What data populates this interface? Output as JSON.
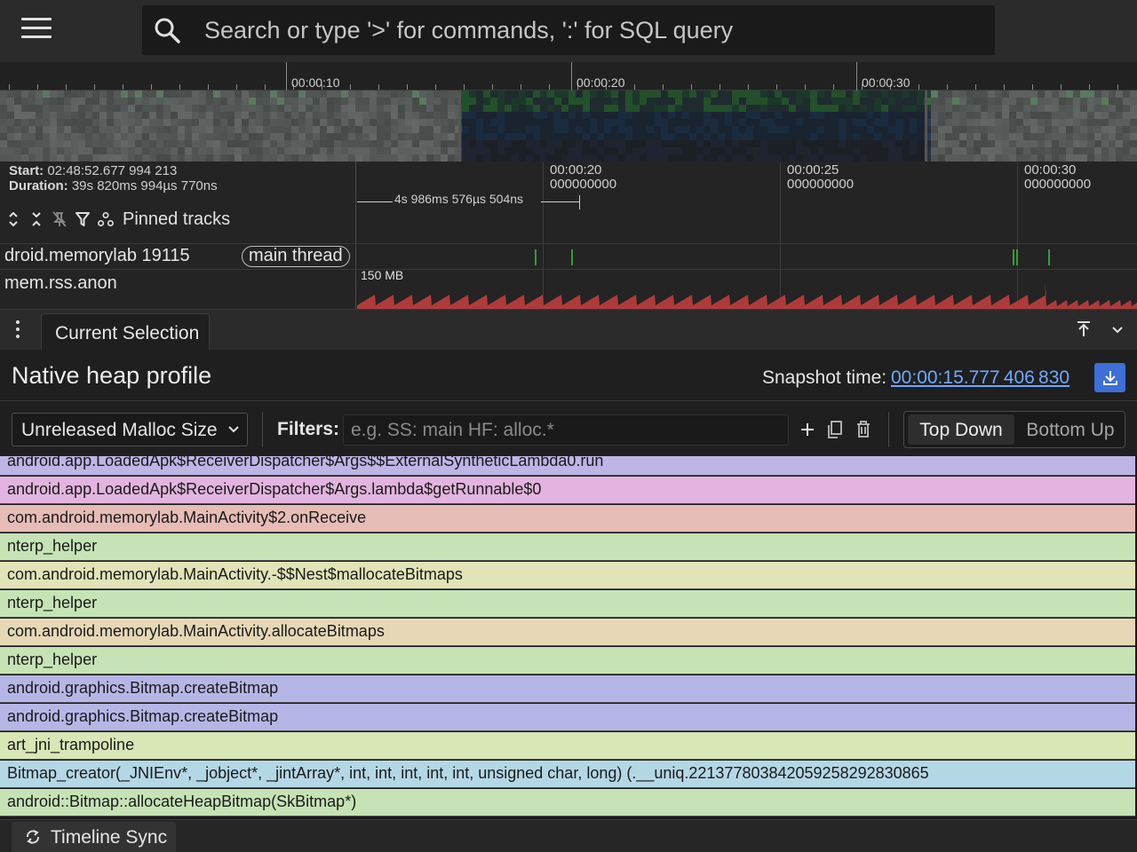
{
  "topbar": {
    "menu_icon": "hamburger-menu-icon",
    "search_icon": "search-icon",
    "search_placeholder": "Search or type '>' for commands, ':' for SQL query"
  },
  "overview": {
    "time_labels": [
      "00:00:10",
      "00:00:20",
      "00:00:30"
    ]
  },
  "tracks": {
    "start_label": "Start:",
    "start_value": "02:48:52.677 994 213",
    "duration_label": "Duration:",
    "duration_value": "39s 820ms 994µs 770ns",
    "pinned_label": "Pinned tracks",
    "span_label": "4s 986ms 576µs 504ns",
    "time_labels": [
      {
        "time": "00:00:20",
        "sub": "000000000"
      },
      {
        "time": "00:00:25",
        "sub": "000000000"
      },
      {
        "time": "00:00:30",
        "sub": "000000000"
      }
    ],
    "process_track": "droid.memorylab 19115",
    "thread_chip": "main thread",
    "counter_track": "mem.rss.anon",
    "counter_value": "150 MB",
    "counter_color": "#b03a3a"
  },
  "panel": {
    "tab_current": "Current Selection",
    "title": "Native heap profile",
    "snapshot_label": "Snapshot time:",
    "snapshot_value": "00:00:15.777 406 830",
    "metric_value": "Unreleased Malloc Size",
    "filters_label": "Filters:",
    "filters_placeholder": "e.g. SS: main HF: alloc.*",
    "view_top_down": "Top Down",
    "view_bottom_up": "Bottom Up",
    "accent": "#3d6fd6"
  },
  "flamegraph": {
    "frames": [
      {
        "label": "android.app.LoadedApk$ReceiverDispatcher$Args$$ExternalSyntheticLambda0.run",
        "color": "#bfb4e6"
      },
      {
        "label": "android.app.LoadedApk$ReceiverDispatcher$Args.lambda$getRunnable$0",
        "color": "#e3b4df"
      },
      {
        "label": "com.android.memorylab.MainActivity$2.onReceive",
        "color": "#e6bcb6"
      },
      {
        "label": "nterp_helper",
        "color": "#c6e3b5"
      },
      {
        "label": "com.android.memorylab.MainActivity.-$$Nest$mallocateBitmaps",
        "color": "#e2e3b7"
      },
      {
        "label": "nterp_helper",
        "color": "#c6e3b5"
      },
      {
        "label": "com.android.memorylab.MainActivity.allocateBitmaps",
        "color": "#e6d8b6"
      },
      {
        "label": "nterp_helper",
        "color": "#c6e3b5"
      },
      {
        "label": "android.graphics.Bitmap.createBitmap",
        "color": "#b6b6e6"
      },
      {
        "label": "android.graphics.Bitmap.createBitmap",
        "color": "#b6b6e6"
      },
      {
        "label": "art_jni_trampoline",
        "color": "#d9e6b6"
      },
      {
        "label": "Bitmap_creator(_JNIEnv*, _jobject*, _jintArray*, int, int, int, int, int, unsigned char, long) (.__uniq.221377803842059258292830865",
        "color": "#b4d7e6"
      },
      {
        "label": "android::Bitmap::allocateHeapBitmap(SkBitmap*)",
        "color": "#c6e3b5"
      }
    ]
  },
  "bottombar": {
    "sync_label": "Timeline Sync"
  }
}
